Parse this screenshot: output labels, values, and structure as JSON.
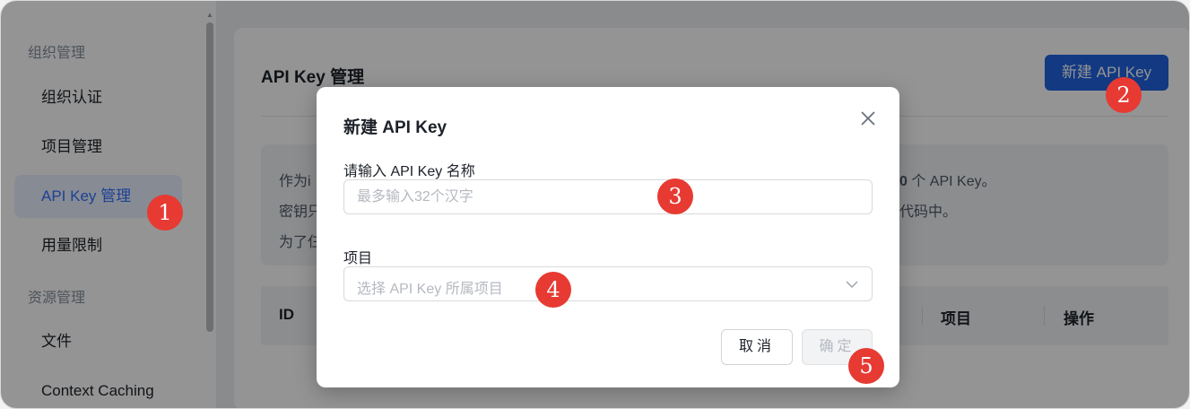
{
  "sidebar": {
    "groups": [
      "组织管理",
      "资源管理"
    ],
    "items": [
      {
        "label": "组织认证"
      },
      {
        "label": "项目管理"
      },
      {
        "label": "API Key 管理"
      },
      {
        "label": "用量限制"
      },
      {
        "label": "文件"
      },
      {
        "label": "Context Caching"
      }
    ],
    "active_index": 2
  },
  "page": {
    "title": "API Key 管理",
    "new_button": "新建 API Key",
    "info": {
      "line1_left": "作为i",
      "line1_right_num": "0",
      "line1_right_text": " 个 API Key。",
      "line2_left": "密钥只",
      "line2_right": "代码中。",
      "line3_left": "为了仨"
    },
    "table_headers": [
      "ID",
      "项目",
      "操作"
    ]
  },
  "modal": {
    "title": "新建 API Key",
    "name_label": "请输入 API Key 名称",
    "name_placeholder": "最多输入32个汉字",
    "project_label": "项目",
    "project_placeholder": "选择 API Key 所属项目",
    "cancel_label": "取消",
    "ok_label": "确定"
  },
  "markers": [
    "1",
    "2",
    "3",
    "4",
    "5"
  ],
  "colors": {
    "accent": "#1f62e0",
    "active_item_bg": "#e8f0ff",
    "marker": "#e63a32"
  }
}
